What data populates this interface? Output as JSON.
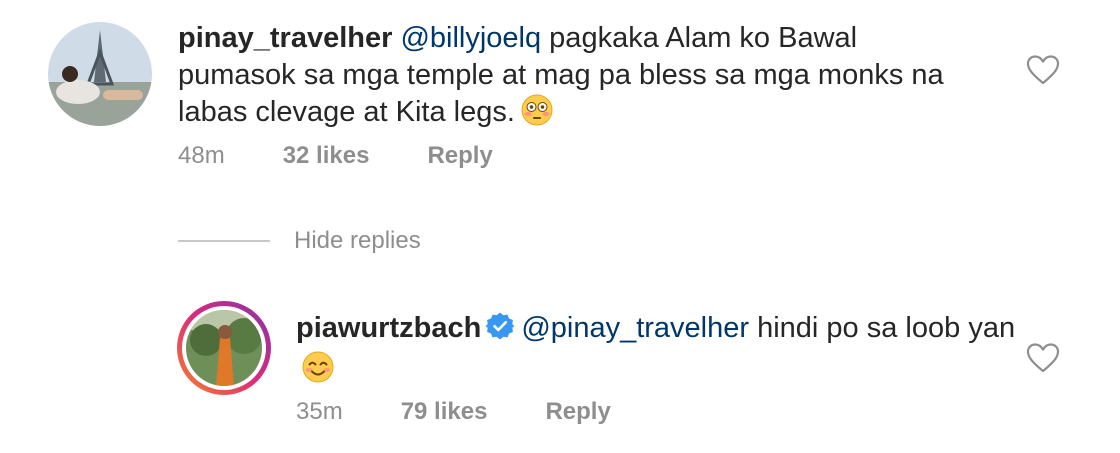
{
  "comments": [
    {
      "username": "pinay_travelher",
      "mention": "@billyjoelq",
      "text": " pagkaka Alam ko Bawal pumasok sa mga temple at mag pa bless sa mga monks na labas clevage at Kita legs.",
      "emoji": "flushed-face",
      "time": "48m",
      "likes": "32 likes",
      "reply": "Reply",
      "verified": false
    },
    {
      "username": "piawurtzbach",
      "mention": "@pinay_travelher",
      "text": " hindi po sa loob yan",
      "emoji": "smiling-face",
      "time": "35m",
      "likes": "79 likes",
      "reply": "Reply",
      "verified": true
    }
  ],
  "hide_replies": "Hide replies",
  "icons": {
    "like": "heart-outline-icon",
    "verified": "verified-badge-icon"
  },
  "colors": {
    "mention": "#00376b",
    "meta": "#8e8e8e",
    "verified": "#3897f0",
    "story_ring": [
      "#f58529",
      "#dd2a7b",
      "#8134af"
    ]
  }
}
